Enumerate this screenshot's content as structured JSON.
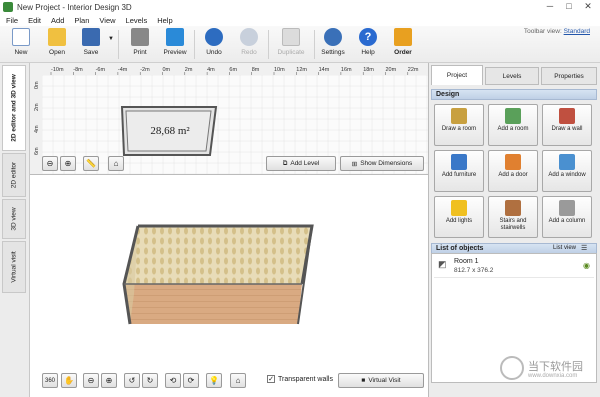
{
  "window": {
    "title": "New Project - Interior Design 3D",
    "minimize": "─",
    "maximize": "□",
    "close": "✕"
  },
  "menu": [
    "File",
    "Edit",
    "Add",
    "Plan",
    "View",
    "Levels",
    "Help"
  ],
  "toolbar": {
    "new": "New",
    "open": "Open",
    "save": "Save",
    "print": "Print",
    "preview": "Preview",
    "undo": "Undo",
    "redo": "Redo",
    "duplicate": "Duplicate",
    "settings": "Settings",
    "help": "Help",
    "order": "Order",
    "view_label": "Toolbar view:",
    "view_value": "Standard"
  },
  "side_tabs": [
    "2D editor and 3D view",
    "2D editor",
    "3D view",
    "Virtual visit"
  ],
  "ruler": {
    "top_labels": [
      "-10m",
      "-8m",
      "-6m",
      "-4m",
      "-2m",
      "0m",
      "2m",
      "4m",
      "6m",
      "8m",
      "10m",
      "12m",
      "14m",
      "16m",
      "18m",
      "20m",
      "22m",
      "24m"
    ],
    "left_labels": [
      "0m",
      "2m",
      "4m",
      "6m"
    ]
  },
  "room_2d": {
    "area": "28,68 m²"
  },
  "editor2d_buttons": {
    "add_level": "Add Level",
    "show_dimensions": "Show Dimensions"
  },
  "view3d_controls": {
    "transparent_walls": "Transparent walls",
    "virtual_visit": "Virtual Visit"
  },
  "right_tabs": [
    "Project",
    "Levels",
    "Properties"
  ],
  "design_header": "Design",
  "design_buttons": [
    {
      "label": "Draw a room",
      "color": "#c8a040"
    },
    {
      "label": "Add a room",
      "color": "#5aa05a"
    },
    {
      "label": "Draw a wall",
      "color": "#c05040"
    },
    {
      "label": "Add furniture",
      "color": "#3a78c8"
    },
    {
      "label": "Add a door",
      "color": "#e08030"
    },
    {
      "label": "Add a window",
      "color": "#4a90d0"
    },
    {
      "label": "Add lights",
      "color": "#f0c020"
    },
    {
      "label": "Stairs and stairwells",
      "color": "#b07040"
    },
    {
      "label": "Add a column",
      "color": "#9a9a9a"
    }
  ],
  "objects": {
    "header": "List of objects",
    "view_toggle": "List view",
    "items": [
      {
        "name": "Room 1",
        "size": "812.7 x 376.2"
      }
    ]
  },
  "watermark": {
    "text": "当下软件园",
    "url": "www.downxia.com"
  }
}
